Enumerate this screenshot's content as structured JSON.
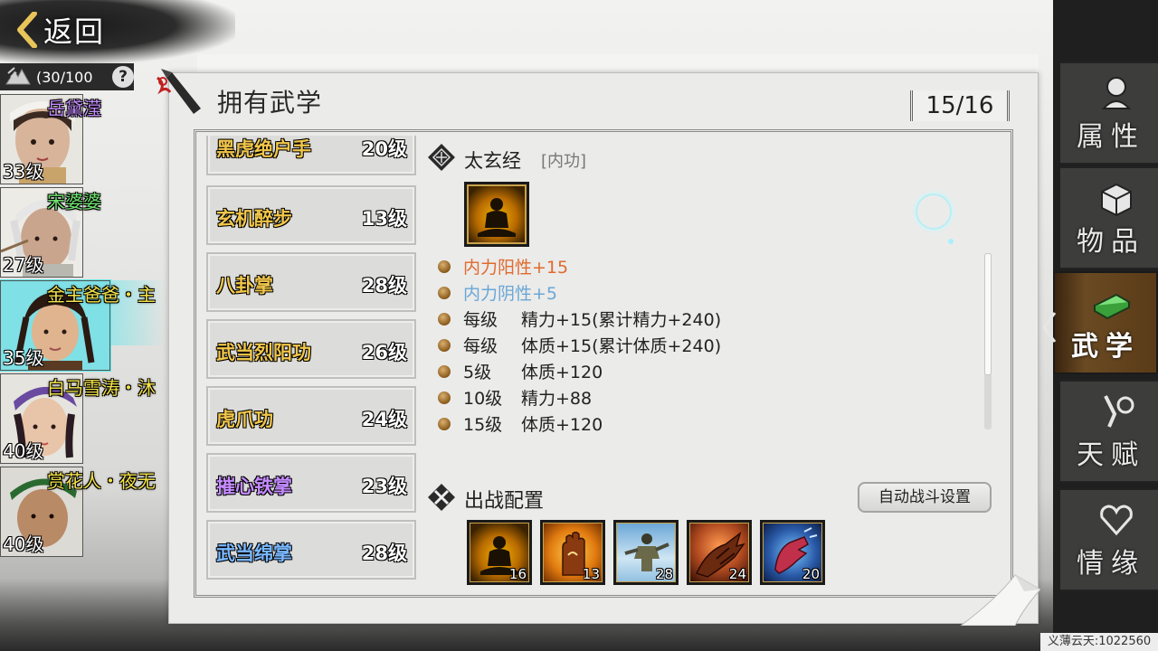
{
  "back": {
    "label": "返回"
  },
  "stamina": {
    "value": "(30/100",
    "help": "?"
  },
  "party": [
    {
      "name": "岳黛滢",
      "level": "33级",
      "name_color": "#c58bff"
    },
    {
      "name": "宋婆婆",
      "level": "27级",
      "name_color": "#6fe36f"
    },
    {
      "name": "金主爸爸・主",
      "level": "35级",
      "name_color": "#f2e24a"
    },
    {
      "name": "白马雪涛・沐",
      "level": "40级",
      "name_color": "#f2e24a"
    },
    {
      "name": "赏花人・夜无",
      "level": "40级",
      "name_color": "#f2e24a"
    }
  ],
  "panel": {
    "title": "拥有武学",
    "count": "15/16"
  },
  "skills": [
    {
      "name": "黑虎绝户手",
      "level": "20级",
      "color": "#f0c64a"
    },
    {
      "name": "玄机醉步",
      "level": "13级",
      "color": "#f0c64a"
    },
    {
      "name": "八卦掌",
      "level": "28级",
      "color": "#f0c64a"
    },
    {
      "name": "武当烈阳功",
      "level": "26级",
      "color": "#f0c64a"
    },
    {
      "name": "虎爪功",
      "level": "24级",
      "color": "#f0c64a"
    },
    {
      "name": "摧心铁掌",
      "level": "23级",
      "color": "#c58bff"
    },
    {
      "name": "武当绵掌",
      "level": "28级",
      "color": "#7ab8ff"
    }
  ],
  "detail": {
    "name": "太玄经",
    "type": "[内功]",
    "effects": [
      {
        "text": "内力阳性+15"
      },
      {
        "text": "内力阴性+5"
      },
      {
        "key": "每级",
        "text": "精力+15(累计精力+240)"
      },
      {
        "key": "每级",
        "text": "体质+15(累计体质+240)"
      },
      {
        "key": "5级",
        "text": "体质+120"
      },
      {
        "key": "10级",
        "text": "精力+88"
      },
      {
        "key": "15级",
        "text": "体质+120"
      }
    ]
  },
  "battle": {
    "title": "出战配置",
    "auto_label": "自动战斗设置",
    "slots": [
      "16",
      "13",
      "28",
      "24",
      "20"
    ]
  },
  "tabs": [
    {
      "label": "属性",
      "icon": "bust-icon"
    },
    {
      "label": "物品",
      "icon": "box-icon"
    },
    {
      "label": "武学",
      "icon": "book-icon"
    },
    {
      "label": "天赋",
      "icon": "weapon-icon"
    },
    {
      "label": "情缘",
      "icon": "heart-icon"
    }
  ],
  "watermark": "义薄云天:1022560"
}
